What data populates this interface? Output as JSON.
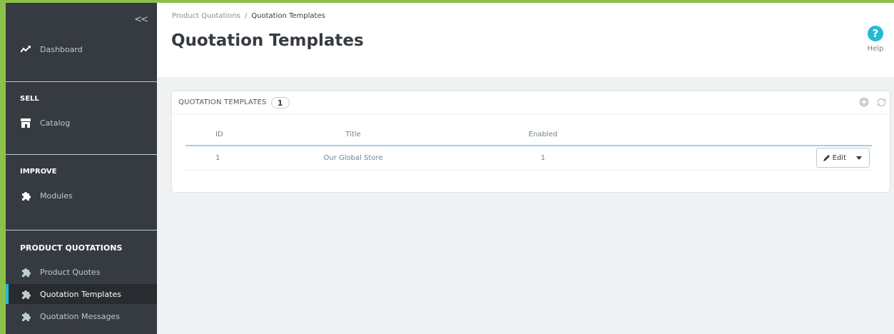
{
  "sidebar": {
    "collapse_label": "<<",
    "dashboard": {
      "label": "Dashboard",
      "icon": "trending-up-icon"
    },
    "sections": [
      {
        "title": "SELL",
        "items": [
          {
            "label": "Catalog",
            "icon": "store-icon"
          }
        ]
      },
      {
        "title": "IMPROVE",
        "items": [
          {
            "label": "Modules",
            "icon": "puzzle-icon"
          }
        ]
      },
      {
        "title": "PRODUCT QUOTATIONS",
        "items": [
          {
            "label": "Product Quotes",
            "icon": "puzzle-icon",
            "active": false
          },
          {
            "label": "Quotation Templates",
            "icon": "puzzle-icon",
            "active": true
          },
          {
            "label": "Quotation Messages",
            "icon": "puzzle-icon",
            "active": false
          }
        ]
      }
    ]
  },
  "header": {
    "breadcrumb": {
      "parent": "Product Quotations",
      "separator": "/",
      "current": "Quotation Templates"
    },
    "title": "Quotation Templates",
    "help_label": "Help",
    "help_glyph": "?"
  },
  "panel": {
    "title": "QUOTATION TEMPLATES",
    "count": "1",
    "actions": [
      "add-icon",
      "refresh-icon"
    ],
    "columns": {
      "id": "ID",
      "title": "Title",
      "enabled": "Enabled"
    },
    "rows": [
      {
        "id": "1",
        "title": "Our Global Store",
        "enabled": "1",
        "action_label": "Edit"
      }
    ]
  },
  "colors": {
    "accent_green": "#8cc04b",
    "sidebar_bg": "#363a41",
    "active_border": "#25b9d7",
    "help_icon": "#25b9d7"
  }
}
